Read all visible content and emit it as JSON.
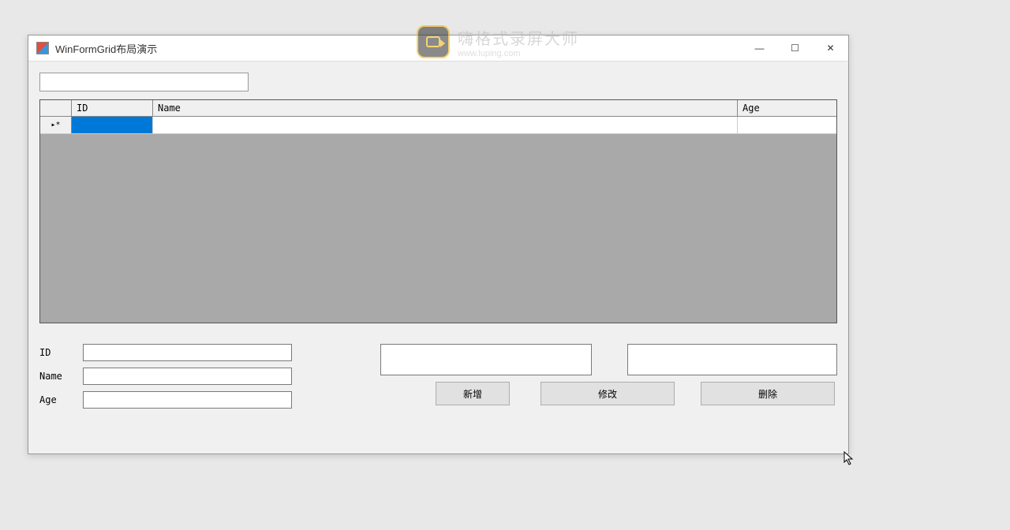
{
  "window": {
    "title": "WinFormGrid布局演示",
    "min_char": "—",
    "max_char": "☐",
    "close_char": "✕"
  },
  "top_input": {
    "value": ""
  },
  "grid": {
    "headers": {
      "id": "ID",
      "name": "Name",
      "age": "Age"
    },
    "row_indicator": "▸*",
    "row": {
      "id": "",
      "name": "",
      "age": ""
    }
  },
  "form": {
    "labels": {
      "id": "ID",
      "name": "Name",
      "age": "Age"
    },
    "values": {
      "id": "",
      "name": "",
      "age": ""
    }
  },
  "panels": {
    "add_text": "",
    "edit_text": ""
  },
  "buttons": {
    "add": "新增",
    "edit": "修改",
    "delete": "删除"
  },
  "watermark": {
    "title": "嗨格式录屏大师",
    "sub": "www.luping.com"
  }
}
